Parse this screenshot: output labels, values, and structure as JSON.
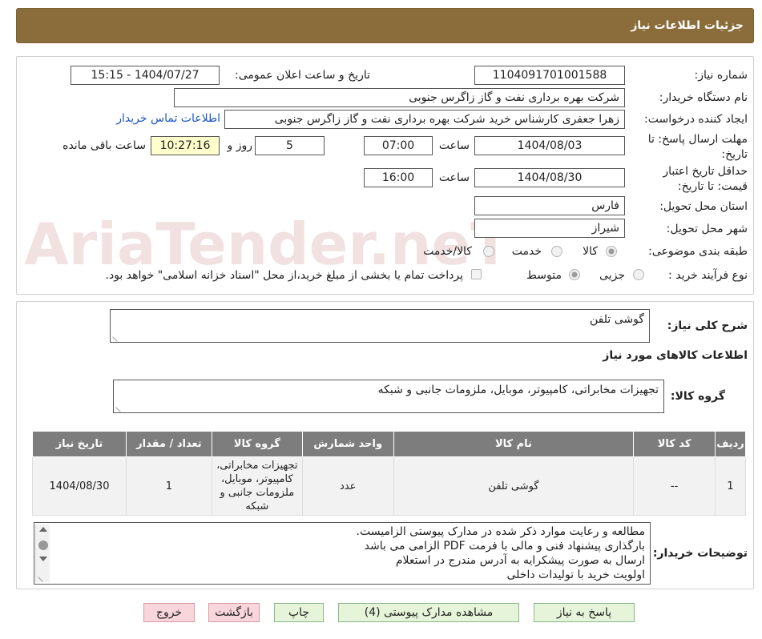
{
  "header": {
    "title": "جزئیات اطلاعات نیاز"
  },
  "info": {
    "need_number_label": "شماره نیاز:",
    "need_number": "1104091701001588",
    "announce_label": "تاریخ و ساعت اعلان عمومی:",
    "announce_value": "1404/07/27 - 15:15",
    "buyer_org_label": "نام دستگاه خریدار:",
    "buyer_org": "شرکت بهره برداری نفت و گاز زاگرس جنوبی",
    "creator_label": "ایجاد کننده درخواست:",
    "creator": "زهرا جعفری کارشناس خرید شرکت بهره برداری نفت و گاز زاگرس جنوبی",
    "contact_link": "اطلاعات تماس خریدار",
    "deadline_label_1": "مهلت ارسال پاسخ: تا",
    "deadline_label_2": "تاریخ:",
    "deadline_date": "1404/08/03",
    "time_label": "ساعت",
    "deadline_time": "07:00",
    "days_value": "5",
    "days_label": "روز و",
    "remaining_time": "10:27:16",
    "remaining_label": "ساعت باقی مانده",
    "validity_label_1": "حداقل تاریخ اعتبار",
    "validity_label_2": "قیمت: تا تاریخ:",
    "validity_date": "1404/08/30",
    "validity_time": "16:00",
    "province_label": "استان محل تحویل:",
    "province": "فارس",
    "city_label": "شهر محل تحویل:",
    "city": "شیراز",
    "category_label": "طبقه بندی موضوعی:",
    "category_options": [
      "کالا",
      "خدمت",
      "کالا/خدمت"
    ],
    "process_label": "نوع فرآیند خرید :",
    "process_options": [
      "جزیی",
      "متوسط"
    ],
    "payment_note": "پرداخت تمام یا بخشی از مبلغ خرید،از محل \"اسناد خزانه اسلامی\" خواهد بود."
  },
  "summary": {
    "general_desc_label": "شرح کلی نیاز:",
    "general_desc": "گوشی تلفن",
    "goods_info_title": "اطلاعات کالاهای مورد نیاز",
    "goods_group_label": "گروه کالا:",
    "goods_group": "تجهیزات مخابراتی، کامپیوتر، موبایل، ملزومات جانبی و شبکه",
    "table": {
      "headers": [
        "ردیف",
        "کد کالا",
        "نام کالا",
        "واحد شمارش",
        "گروه کالا",
        "تعداد / مقدار",
        "تاریخ نیاز"
      ],
      "rows": [
        [
          "1",
          "--",
          "گوشی تلفن",
          "عدد",
          "تجهیزات مخابراتی، کامپیوتر، موبایل، ملزومات جانبی و شبکه",
          "1",
          "1404/08/30"
        ]
      ]
    },
    "buyer_notes_label": "توضیحات خریدار:",
    "buyer_notes": [
      "مطالعه و رعایت موارد ذکر شده در مدارک پیوستی الزامیست.",
      "بارگذاری پیشنهاد فنی و مالی با فرمت PDF الزامی می باشد",
      "ارسال به صورت پیشکرایه به آدرس مندرج در استعلام",
      "اولویت خرید با تولیدات داخلی"
    ]
  },
  "buttons": {
    "reply": "پاسخ به نیاز",
    "attachments": "مشاهده مدارک پیوستی (4)",
    "print": "چاپ",
    "back": "بازگشت",
    "exit": "خروج"
  },
  "watermark": {
    "text": "AriaTender.neT"
  }
}
